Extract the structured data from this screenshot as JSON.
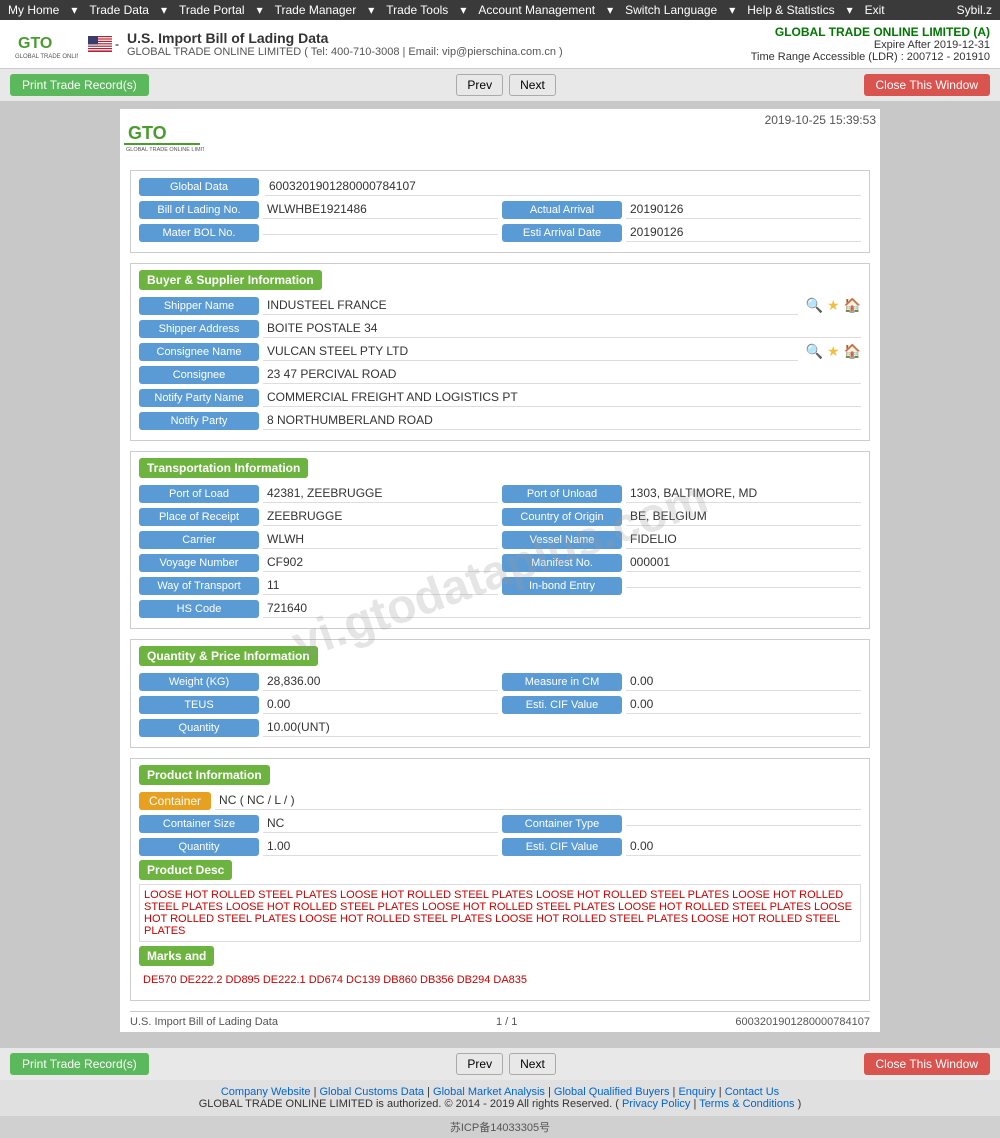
{
  "topnav": {
    "items": [
      "My Home",
      "Trade Data",
      "Trade Portal",
      "Trade Manager",
      "Trade Tools",
      "Account Management",
      "Switch Language",
      "Help & Statistics",
      "Exit"
    ],
    "user": "Sybil.z"
  },
  "header": {
    "title": "U.S. Import Bill of Lading Data",
    "subtitle": "GLOBAL TRADE ONLINE LIMITED ( Tel: 400-710-3008 | Email: vip@pierschina.com.cn )",
    "company": "GLOBAL TRADE ONLINE LIMITED (A)",
    "expire": "Expire After 2019-12-31",
    "timeRange": "Time Range Accessible (LDR) : 200712 - 201910"
  },
  "toolbar": {
    "print_label": "Print Trade Record(s)",
    "prev_label": "Prev",
    "next_label": "Next",
    "close_label": "Close This Window"
  },
  "document": {
    "timestamp": "2019-10-25 15:39:53",
    "global_data_label": "Global Data",
    "global_data_value": "6003201901280000784107",
    "bol_no_label": "Bill of Lading No.",
    "bol_no_value": "WLWHBE1921486",
    "actual_arrival_label": "Actual Arrival",
    "actual_arrival_value": "20190126",
    "master_bol_label": "Mater BOL No.",
    "master_bol_value": "",
    "esti_arrival_label": "Esti Arrival Date",
    "esti_arrival_value": "20190126"
  },
  "buyer_supplier": {
    "section_title": "Buyer & Supplier Information",
    "shipper_name_label": "Shipper Name",
    "shipper_name_value": "INDUSTEEL FRANCE",
    "shipper_address_label": "Shipper Address",
    "shipper_address_value": "BOITE POSTALE 34",
    "consignee_name_label": "Consignee Name",
    "consignee_name_value": "VULCAN STEEL PTY LTD",
    "consignee_label": "Consignee",
    "consignee_value": "23 47 PERCIVAL ROAD",
    "notify_party_name_label": "Notify Party Name",
    "notify_party_name_value": "COMMERCIAL FREIGHT AND LOGISTICS PT",
    "notify_party_label": "Notify Party",
    "notify_party_value": "8 NORTHUMBERLAND ROAD"
  },
  "transportation": {
    "section_title": "Transportation Information",
    "port_of_load_label": "Port of Load",
    "port_of_load_value": "42381, ZEEBRUGGE",
    "port_of_unload_label": "Port of Unload",
    "port_of_unload_value": "1303, BALTIMORE, MD",
    "place_of_receipt_label": "Place of Receipt",
    "place_of_receipt_value": "ZEEBRUGGE",
    "country_of_origin_label": "Country of Origin",
    "country_of_origin_value": "BE, BELGIUM",
    "carrier_label": "Carrier",
    "carrier_value": "WLWH",
    "vessel_name_label": "Vessel Name",
    "vessel_name_value": "FIDELIO",
    "voyage_number_label": "Voyage Number",
    "voyage_number_value": "CF902",
    "manifest_no_label": "Manifest No.",
    "manifest_no_value": "000001",
    "way_of_transport_label": "Way of Transport",
    "way_of_transport_value": "11",
    "inbond_entry_label": "In-bond Entry",
    "inbond_entry_value": "",
    "hs_code_label": "HS Code",
    "hs_code_value": "721640"
  },
  "quantity_price": {
    "section_title": "Quantity & Price Information",
    "weight_label": "Weight (KG)",
    "weight_value": "28,836.00",
    "measure_cm_label": "Measure in CM",
    "measure_cm_value": "0.00",
    "teus_label": "TEUS",
    "teus_value": "0.00",
    "esti_cif_label": "Esti. CIF Value",
    "esti_cif_value": "0.00",
    "quantity_label": "Quantity",
    "quantity_value": "10.00(UNT)"
  },
  "product_info": {
    "section_title": "Product Information",
    "container_label": "Container",
    "container_value": "NC ( NC / L / )",
    "container_size_label": "Container Size",
    "container_size_value": "NC",
    "container_type_label": "Container Type",
    "container_type_value": "",
    "quantity_label": "Quantity",
    "quantity_value": "1.00",
    "esti_cif_label": "Esti. CIF Value",
    "esti_cif_value": "0.00",
    "product_desc_title": "Product Desc",
    "product_desc_text": "LOOSE HOT ROLLED STEEL PLATES LOOSE HOT ROLLED STEEL PLATES LOOSE HOT ROLLED STEEL PLATES LOOSE HOT ROLLED STEEL PLATES LOOSE HOT ROLLED STEEL PLATES LOOSE HOT ROLLED STEEL PLATES LOOSE HOT ROLLED STEEL PLATES LOOSE HOT ROLLED STEEL PLATES LOOSE HOT ROLLED STEEL PLATES LOOSE HOT ROLLED STEEL PLATES LOOSE HOT ROLLED STEEL PLATES",
    "marks_title": "Marks and",
    "marks_value": "DE570 DE222.2 DD895 DE222.1 DD674 DC139 DB860 DB356 DB294 DA835"
  },
  "doc_footer": {
    "label": "U.S. Import Bill of Lading Data",
    "page": "1 / 1",
    "id": "6003201901280000784107"
  },
  "page_footer": {
    "links": [
      "Company Website",
      "Global Customs Data",
      "Global Market Analysis",
      "Global Qualified Buyers",
      "Enquiry",
      "Contact Us"
    ],
    "copyright": "GLOBAL TRADE ONLINE LIMITED is authorized. © 2014 - 2019 All rights Reserved.",
    "privacy": "Privacy Policy",
    "terms": "Terms & Conditions",
    "icp": "苏ICP备14033305号"
  }
}
